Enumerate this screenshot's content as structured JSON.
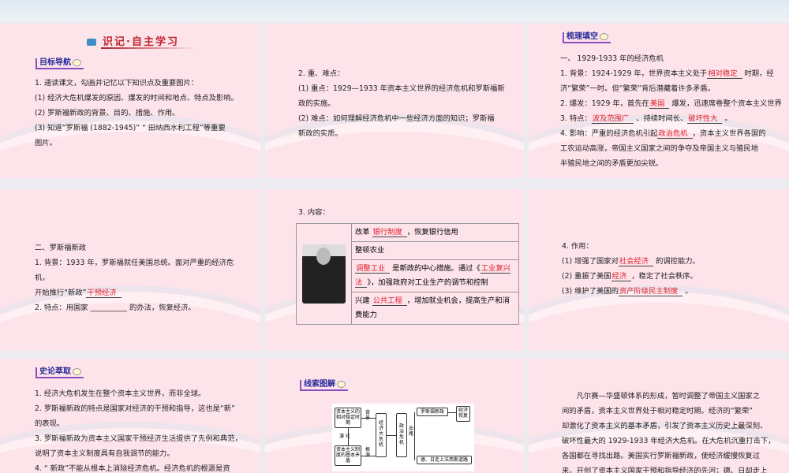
{
  "p1": {
    "title": "识记·自主学习",
    "tag": "目标导航",
    "lines": [
      [
        {
          "t": "1. 通读课文，勾画并记忆以下知识点及重要图片："
        }
      ],
      [
        {
          "t": "(1) 经济大危机爆发的原因、爆发的时间和地点、特点及影响。"
        }
      ],
      [
        {
          "t": "(2) 罗斯福新政的背景、目的、措施、作用。"
        }
      ],
      [
        {
          "t": "(3) 知道“罗斯福 (1882-1945)” “ 田纳西水利工程”等重要"
        }
      ],
      [
        {
          "t": "图片。"
        }
      ]
    ]
  },
  "p2": {
    "lines": [
      [
        {
          "t": "2. 重、难点："
        }
      ],
      [
        {
          "t": "(1) 重点：1929—1933 年资本主义世界的经济危机和罗斯福新"
        }
      ],
      [
        {
          "t": "政的实施。"
        }
      ],
      [
        {
          "t": "(2) 难点：如何理解经济危机中一些经济方面的知识；罗斯福"
        }
      ],
      [
        {
          "t": "新政的实质。"
        }
      ]
    ]
  },
  "p3": {
    "tag": "梳理填空",
    "lines": [
      [
        {
          "t": "一、 1929-1933 年的经济危机"
        }
      ],
      [
        {
          "t": "1. 背景：1924-1929 年，世界资本主义处于"
        },
        {
          "f": "相对稳定"
        },
        {
          "t": " 时期，经"
        }
      ],
      [
        {
          "t": "济“繁荣”一时。但“繁荣”背后潜藏着许多矛盾。"
        }
      ],
      [
        {
          "t": "2. 爆发：1929 年，首先在"
        },
        {
          "f": "美国"
        },
        {
          "t": " 爆发，迅速席卷整个资本主义世界"
        }
      ],
      [
        {
          "t": "3. 特点："
        },
        {
          "f": "波及范围广"
        },
        {
          "t": " 、持续时间长、"
        },
        {
          "f": "破坏性大"
        },
        {
          "t": " 。"
        }
      ],
      [
        {
          "t": "4. 影响：严重的经济危机引起"
        },
        {
          "f": "政治危机"
        },
        {
          "t": "，资本主义世界各国的"
        }
      ],
      [
        {
          "t": "工农运动高涨，帝国主义国家之间的争夺及帝国主义与殖民地"
        }
      ],
      [
        {
          "t": "半殖民地之间的矛盾更加尖锐。"
        }
      ]
    ]
  },
  "p4": {
    "lines": [
      [
        {
          "t": "二、罗斯福新政"
        }
      ],
      [
        {
          "t": "1. 背景：1933 年，罗斯福就任美国总统。面对严重的经济危"
        }
      ],
      [
        {
          "t": "机，"
        }
      ],
      [
        {
          "t": "开始推行“新政”"
        },
        {
          "f": "干预经济"
        }
      ],
      [
        {
          "t": "2. 特点：用国家 __________ 的办法，恢复经济。"
        }
      ]
    ]
  },
  "p5": {
    "heading": "3. 内容：",
    "rows": [
      [
        {
          "t": "改革 "
        },
        {
          "f": "银行制度"
        },
        {
          "t": "，恢复银行信用"
        }
      ],
      [
        {
          "t": "整顿农业"
        }
      ],
      [
        {
          "f": "调整工业"
        },
        {
          "t": " 是新政的中心措施。通过《"
        },
        {
          "f": "工业复兴法"
        },
        {
          "t": "》，加强政府对工业生产的调节和控制"
        }
      ],
      [
        {
          "t": "兴建 "
        },
        {
          "f": "公共工程"
        },
        {
          "t": "，增加就业机会，提高生产和消费能力"
        }
      ]
    ]
  },
  "p6": {
    "lines": [
      [
        {
          "t": "4. 作用："
        }
      ],
      [
        {
          "t": "(1) 增强了国家对"
        },
        {
          "f": "社会经济"
        },
        {
          "t": " 的调控能力。"
        }
      ],
      [
        {
          "t": "(2) 重振了美国"
        },
        {
          "f": "经济"
        },
        {
          "t": "，稳定了社会秩序。"
        }
      ],
      [
        {
          "t": "(3) 维护了美国的"
        },
        {
          "f": "资产阶级民主制度"
        },
        {
          "t": " 。"
        }
      ]
    ]
  },
  "p7": {
    "tag": "史论萃取",
    "lines": [
      [
        {
          "t": "1. 经济大危机发生在整个资本主义世界，而非全球。"
        }
      ],
      [
        {
          "t": "2. 罗斯福新政的特点是国家对经济的干预和指导，这也是“新”"
        }
      ],
      [
        {
          "t": "的表现。"
        }
      ],
      [
        {
          "t": "3. 罗斯福新政为资本主义国家干预经济生活提供了先例和典范，"
        }
      ],
      [
        {
          "t": "说明了资本主义制度具有自我调节的能力。"
        }
      ],
      [
        {
          "t": "4. “ 新政”不能从根本上消除经济危机。经济危机的根源是资"
        }
      ]
    ]
  },
  "p8": {
    "tag": "线索图解",
    "diagram": {
      "stable": "资本主义的相对稳定时期",
      "contradiction": "资本主义制度的基本矛盾",
      "evolve": "演 化",
      "background": "背景",
      "root": "根源",
      "crisis": "经济大危机",
      "political": "政治危机",
      "outlet": "出路",
      "new_deal": "罗斯福新政",
      "recovery": "经济恢复",
      "fascism": "德、日走上法西斯道路"
    }
  },
  "p9": {
    "lines": [
      [
        {
          "t": "　　凡尔赛—华盛顿体系的形成，暂时调整了帝国主义国家之"
        }
      ],
      [
        {
          "t": "间的矛盾，资本主义世界处于相对稳定时期。经济的“繁荣”"
        }
      ],
      [
        {
          "t": "却激化了资本主义的基本矛盾，引发了资本主义历史上最深刻、"
        }
      ],
      [
        {
          "t": "破坏性最大的 1929-1933 年经济大危机。在大危机沉重打击下，"
        }
      ],
      [
        {
          "t": "各国都在寻找出路。美国实行罗斯福新政，使经济缓慢恢复过"
        }
      ],
      [
        {
          "t": "来，开创了资本主义国家干预和指导经济的先河；德、日却走上"
        }
      ]
    ]
  }
}
